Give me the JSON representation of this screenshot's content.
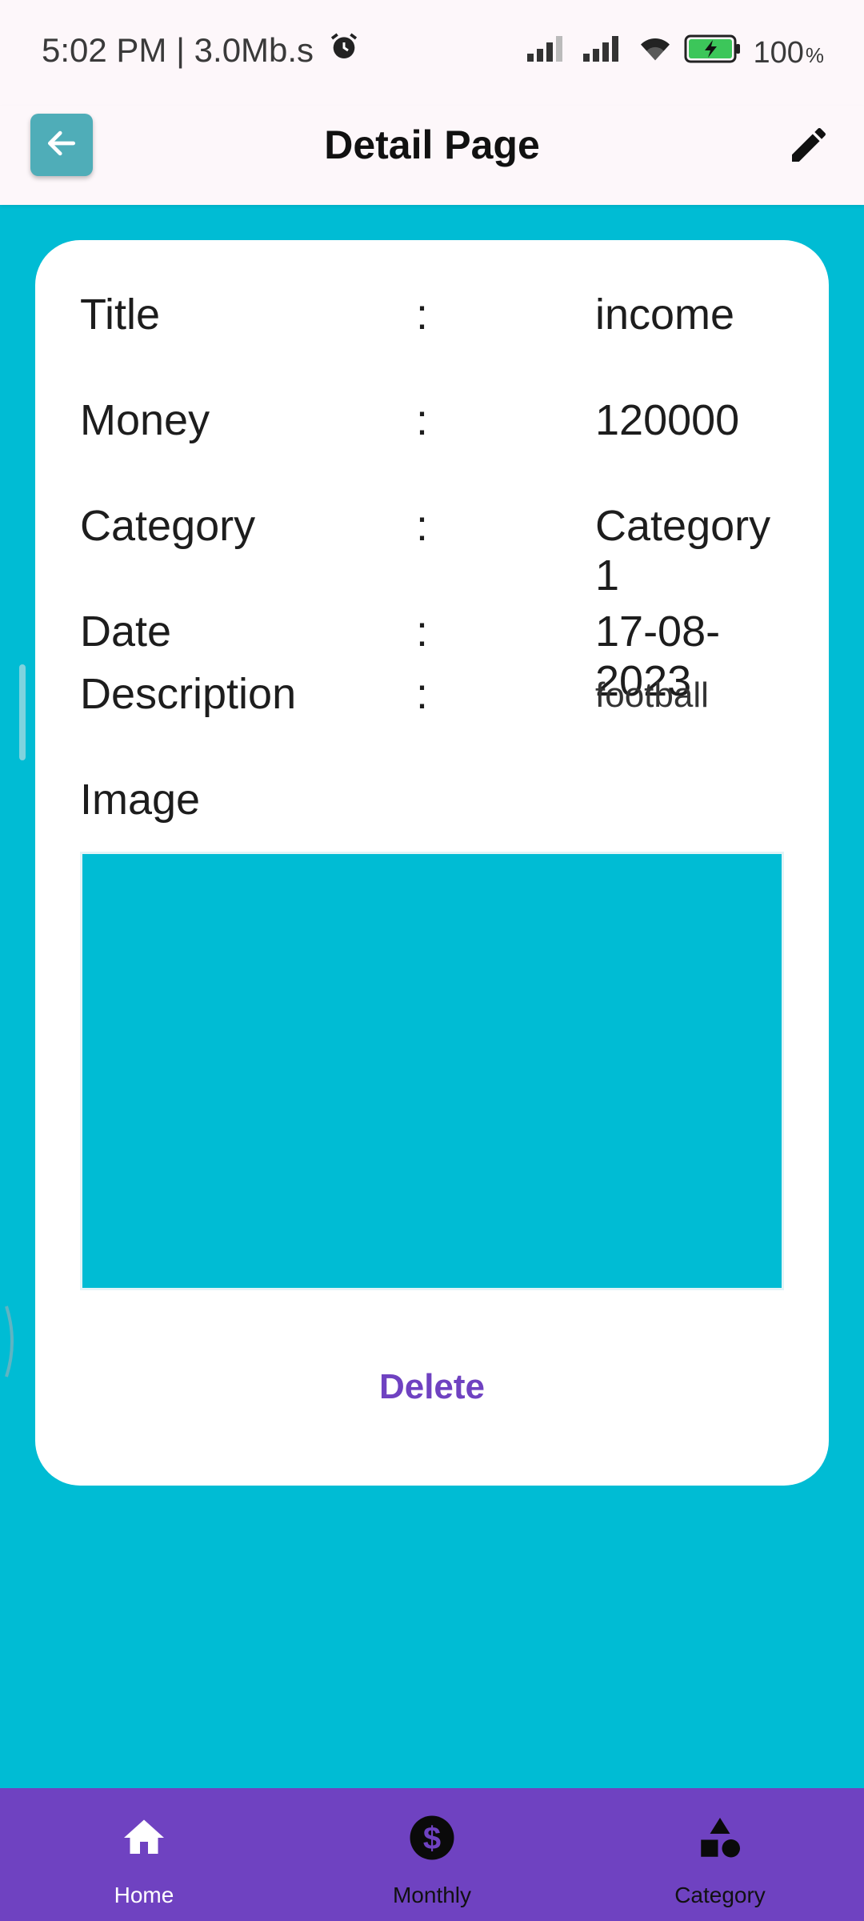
{
  "status_bar": {
    "time_speed": "5:02 PM | 3.0Mb.s",
    "battery_value": "100",
    "battery_unit": "%"
  },
  "app_bar": {
    "title": "Detail Page"
  },
  "detail": {
    "separator": ":",
    "rows": [
      {
        "label": "Title",
        "value": "income"
      },
      {
        "label": "Money",
        "value": "120000"
      },
      {
        "label": "Category",
        "value": "Category 1"
      },
      {
        "label": "Date",
        "value": "17-08-2023"
      },
      {
        "label": "Description",
        "value": "football"
      }
    ],
    "image_label": "Image",
    "image_placeholder_color": "#00BCD4",
    "delete_label": "Delete"
  },
  "bottom_nav": {
    "items": [
      {
        "label": "Home",
        "icon": "home-icon",
        "active": true
      },
      {
        "label": "Monthly",
        "icon": "dollar-icon",
        "active": false
      },
      {
        "label": "Category",
        "icon": "shapes-icon",
        "active": false
      }
    ]
  },
  "colors": {
    "background": "#00BCD4",
    "bars": "#FDF7FA",
    "accent": "#6F42C1",
    "back_button": "#4FADB8"
  }
}
